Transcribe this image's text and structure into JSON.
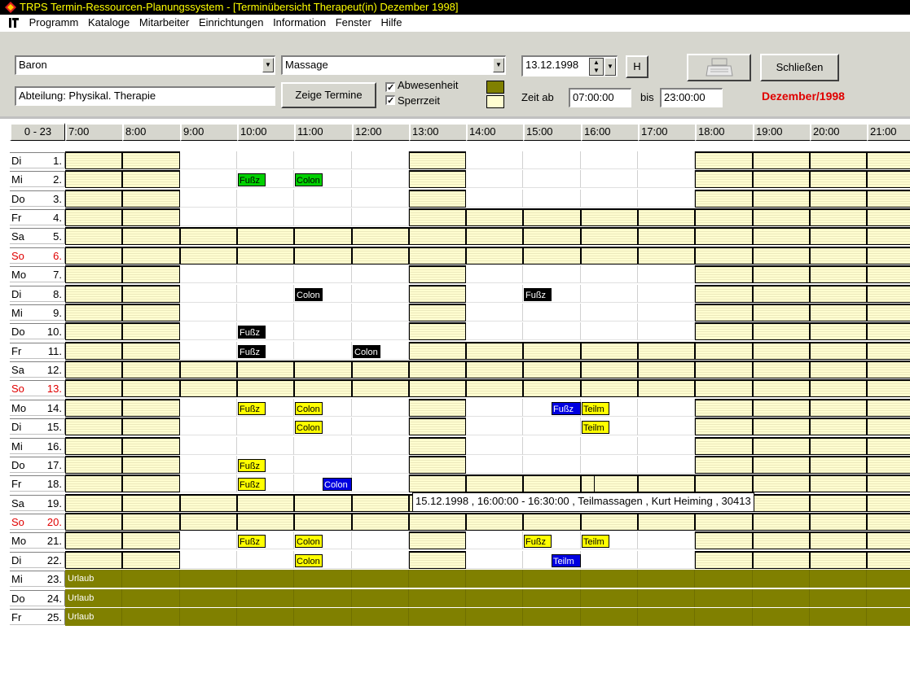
{
  "title": "TRPS Termin-Ressourcen-Planungssystem - [Terminübersicht Therapeut(in) Dezember 1998]",
  "menu": [
    "Programm",
    "Kataloge",
    "Mitarbeiter",
    "Einrichtungen",
    "Information",
    "Fenster",
    "Hilfe"
  ],
  "filters": {
    "therapist": "Baron",
    "treatment": "Massage",
    "department": "Abteilung: Physikal. Therapie",
    "show_button": "Zeige Termine",
    "absence_label": "Abwesenheit",
    "block_label": "Sperrzeit",
    "absence_checked": true,
    "block_checked": true,
    "absence_color": "#808000",
    "block_color": "#fffdd0",
    "date": "13.12.1998",
    "h_button": "H",
    "close_button": "Schließen",
    "time_from_label": "Zeit ab",
    "time_from": "07:00:00",
    "time_to_label": "bis",
    "time_to": "23:00:00",
    "month_label": "Dezember/1998",
    "month_color": "#e00000"
  },
  "header": {
    "range_button": "0 - 23",
    "hours": [
      "7:00",
      "8:00",
      "9:00",
      "10:00",
      "11:00",
      "12:00",
      "13:00",
      "14:00",
      "15:00",
      "16:00",
      "17:00",
      "18:00",
      "19:00",
      "20:00",
      "21:00"
    ]
  },
  "days": [
    {
      "wd": "Di",
      "d": "1.",
      "pattern": "BBWWWWBWWWWBBBB",
      "appts": []
    },
    {
      "wd": "Mi",
      "d": "2.",
      "pattern": "BBWWWWBWWWWBBBB",
      "appts": [
        {
          "h": 3,
          "off": 0,
          "w": 34,
          "text": "Fußz",
          "color": "green"
        },
        {
          "h": 4,
          "off": 0,
          "w": 34,
          "text": "Colon",
          "color": "green"
        }
      ]
    },
    {
      "wd": "Do",
      "d": "3.",
      "pattern": "BBWWWWBWWWWBBBB",
      "appts": []
    },
    {
      "wd": "Fr",
      "d": "4.",
      "pattern": "BBWWWWBBBBBBBBB",
      "appts": []
    },
    {
      "wd": "Sa",
      "d": "5.",
      "pattern": "BBBBBBBBBBBBBBB",
      "appts": []
    },
    {
      "wd": "So",
      "d": "6.",
      "red": true,
      "pattern": "BBBBBBBBBBBBBBB",
      "appts": []
    },
    {
      "wd": "Mo",
      "d": "7.",
      "pattern": "BBWWWWBWWWWBBBB",
      "appts": []
    },
    {
      "wd": "Di",
      "d": "8.",
      "pattern": "BBWWWWBWWWWBBBB",
      "appts": [
        {
          "h": 4,
          "off": 0,
          "w": 34,
          "text": "Colon",
          "color": "black"
        },
        {
          "h": 8,
          "off": 0,
          "w": 34,
          "text": "Fußz",
          "color": "black"
        }
      ]
    },
    {
      "wd": "Mi",
      "d": "9.",
      "pattern": "BBWWWWBWWWWBBBB",
      "appts": []
    },
    {
      "wd": "Do",
      "d": "10.",
      "pattern": "BBWWWWBWWWWBBBB",
      "appts": [
        {
          "h": 3,
          "off": 0,
          "w": 34,
          "text": "Fußz",
          "color": "black"
        }
      ]
    },
    {
      "wd": "Fr",
      "d": "11.",
      "pattern": "BBWWWWBBBBBBBBB",
      "appts": [
        {
          "h": 3,
          "off": 0,
          "w": 34,
          "text": "Fußz",
          "color": "black"
        },
        {
          "h": 5,
          "off": 0,
          "w": 34,
          "text": "Colon",
          "color": "black"
        }
      ]
    },
    {
      "wd": "Sa",
      "d": "12.",
      "pattern": "BBBBBBBBBBBBBBB",
      "appts": []
    },
    {
      "wd": "So",
      "d": "13.",
      "red": true,
      "pattern": "BBBBBBBBBBBBBBB",
      "appts": []
    },
    {
      "wd": "Mo",
      "d": "14.",
      "pattern": "BBWWWWBWWWWBBBB",
      "appts": [
        {
          "h": 3,
          "off": 0,
          "w": 34,
          "text": "Fußz",
          "color": "yellow"
        },
        {
          "h": 4,
          "off": 0,
          "w": 34,
          "text": "Colon",
          "color": "yellow"
        },
        {
          "h": 8,
          "off": 34,
          "w": 36,
          "text": "Fußz",
          "color": "blue"
        },
        {
          "h": 9,
          "off": 0,
          "w": 34,
          "text": "Teilm",
          "color": "yellow"
        }
      ]
    },
    {
      "wd": "Di",
      "d": "15.",
      "pattern": "BBWWWWBWWWWBBBB",
      "appts": [
        {
          "h": 4,
          "off": 0,
          "w": 34,
          "text": "Colon",
          "color": "yellow"
        },
        {
          "h": 9,
          "off": 0,
          "w": 34,
          "text": "Teilm",
          "color": "yellow"
        }
      ]
    },
    {
      "wd": "Mi",
      "d": "16.",
      "pattern": "BBWWWWBWWWWBBBB",
      "appts": []
    },
    {
      "wd": "Do",
      "d": "17.",
      "pattern": "BBWWWWBWWWWBBBB",
      "appts": [
        {
          "h": 3,
          "off": 0,
          "w": 34,
          "text": "Fußz",
          "color": "yellow"
        }
      ]
    },
    {
      "wd": "Fr",
      "d": "18.",
      "pattern": "BBWWWWBBBBBBBBB",
      "appts": [
        {
          "h": 3,
          "off": 0,
          "w": 34,
          "text": "Fußz",
          "color": "yellow"
        },
        {
          "h": 4,
          "off": 34,
          "w": 36,
          "text": "Colon",
          "color": "blue"
        }
      ]
    },
    {
      "wd": "Sa",
      "d": "19.",
      "pattern": "BBBBBBBBBBBBBBB",
      "appts": []
    },
    {
      "wd": "So",
      "d": "20.",
      "red": true,
      "pattern": "BBBBBBBBBBBBBBB",
      "appts": []
    },
    {
      "wd": "Mo",
      "d": "21.",
      "pattern": "BBWWWWBWWWWBBBB",
      "appts": [
        {
          "h": 3,
          "off": 0,
          "w": 34,
          "text": "Fußz",
          "color": "yellow"
        },
        {
          "h": 4,
          "off": 0,
          "w": 34,
          "text": "Colon",
          "color": "yellow"
        },
        {
          "h": 8,
          "off": 0,
          "w": 34,
          "text": "Fußz",
          "color": "yellow"
        },
        {
          "h": 9,
          "off": 0,
          "w": 34,
          "text": "Teilm",
          "color": "yellow"
        }
      ]
    },
    {
      "wd": "Di",
      "d": "22.",
      "pattern": "BBWWWWBWWWWBBBB",
      "appts": [
        {
          "h": 4,
          "off": 0,
          "w": 34,
          "text": "Colon",
          "color": "yellow"
        },
        {
          "h": 8,
          "off": 34,
          "w": 36,
          "text": "Teilm",
          "color": "blue"
        }
      ]
    },
    {
      "wd": "Mi",
      "d": "23.",
      "pattern": "UUUUUUUUUUUUUUU",
      "appts": [],
      "label": "Urlaub"
    },
    {
      "wd": "Do",
      "d": "24.",
      "pattern": "UUUUUUUUUUUUUUU",
      "appts": [],
      "label": "Urlaub"
    },
    {
      "wd": "Fr",
      "d": "25.",
      "pattern": "UUUUUUUUUUUUUUU",
      "appts": [],
      "label": "Urlaub"
    }
  ],
  "tooltip": "15.12.1998 , 16:00:00 - 16:30:00 , Teilmassagen , Kurt Heiming ,  30413",
  "appt_colors": {
    "green": "#00d000",
    "black": "#000000",
    "yellow": "#ffff00",
    "blue": "#0000e0"
  }
}
